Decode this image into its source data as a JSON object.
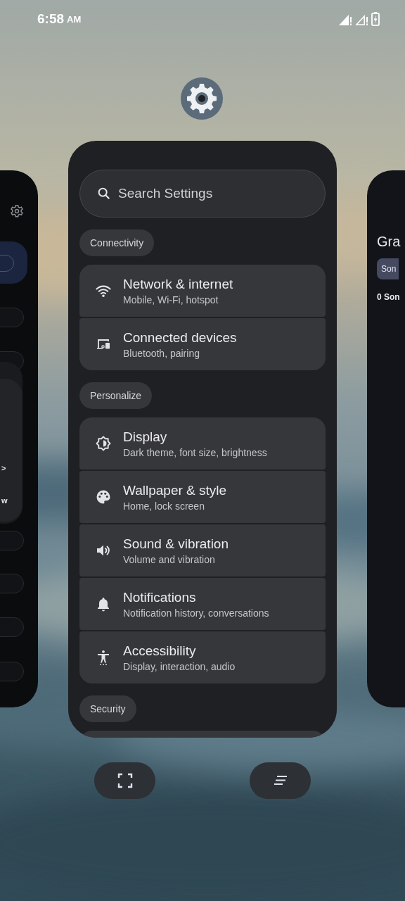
{
  "status_bar": {
    "time": "6:58",
    "meridiem": "AM"
  },
  "left_app": {
    "highlighted_toggle": {
      "on": false
    },
    "toggles": [
      {
        "on": false
      },
      {
        "on": false
      },
      {
        "on": false
      },
      {
        "on": false
      },
      {
        "on": false
      },
      {
        "on": false
      }
    ],
    "popup_lines": [
      ">",
      "w"
    ]
  },
  "settings_app": {
    "search": {
      "placeholder": "Search Settings"
    },
    "sections": [
      {
        "title": "Connectivity",
        "items": [
          {
            "kind": "wifi",
            "title": "Network & internet",
            "subtitle": "Mobile, Wi-Fi, hotspot"
          },
          {
            "kind": "devices",
            "title": "Connected devices",
            "subtitle": "Bluetooth, pairing"
          }
        ]
      },
      {
        "title": "Personalize",
        "items": [
          {
            "kind": "display",
            "title": "Display",
            "subtitle": "Dark theme, font size, brightness"
          },
          {
            "kind": "palette",
            "title": "Wallpaper & style",
            "subtitle": "Home, lock screen"
          },
          {
            "kind": "volume",
            "title": "Sound & vibration",
            "subtitle": "Volume and vibration"
          },
          {
            "kind": "bell",
            "title": "Notifications",
            "subtitle": "Notification history, conversations"
          },
          {
            "kind": "accessibility",
            "title": "Accessibility",
            "subtitle": "Display, interaction, audio"
          }
        ]
      },
      {
        "title": "Security",
        "more_below": true
      }
    ]
  },
  "right_app": {
    "title": "Gra",
    "chip": "Son",
    "count": "0 Son"
  },
  "actions": [
    {
      "kind": "screenshot"
    },
    {
      "kind": "select"
    }
  ]
}
